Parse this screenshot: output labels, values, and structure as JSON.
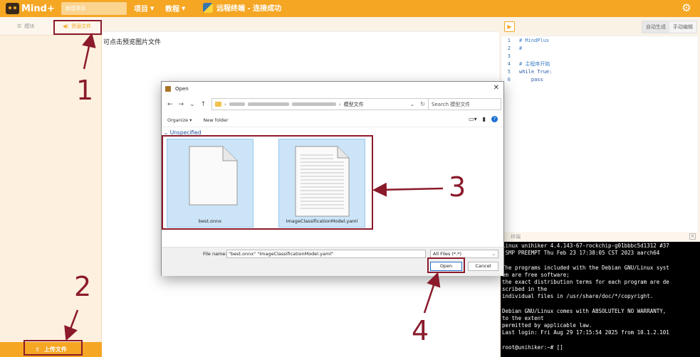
{
  "app": {
    "logo_text": "Mind+",
    "project_name": "新建项目",
    "menus": [
      {
        "label": "项目"
      },
      {
        "label": "教程"
      }
    ],
    "status_text": "远程终端 - 连接成功"
  },
  "left_panel": {
    "tabs": [
      {
        "label": "模块"
      },
      {
        "label": "资源文件"
      }
    ],
    "upload_label": "上传文件"
  },
  "middle": {
    "preview_tip": "可点击预览图片文件"
  },
  "editor": {
    "mode_tabs": [
      "自动生成",
      "手动编辑"
    ],
    "lines": [
      {
        "n": "1",
        "text": "# MindPlus"
      },
      {
        "n": "2",
        "text": "#"
      },
      {
        "n": "3",
        "text": ""
      },
      {
        "n": "4",
        "text": "# 主程序开始"
      },
      {
        "n": "5",
        "text": "while True:"
      },
      {
        "n": "6",
        "text": "    pass"
      }
    ]
  },
  "terminal": {
    "title": "终端",
    "output": "Linux unihiker 4.4.143-67-rockchip-g01bbbc5d1312 #37\n SMP PREEMPT Thu Feb 23 17:38:05 CST 2023 aarch64\n\nThe programs included with the Debian GNU/Linux syst\nem are free software;\nthe exact distribution terms for each program are de\nscribed in the\nindividual files in /usr/share/doc/*/copyright.\n\nDebian GNU/Linux comes with ABSOLUTELY NO WARRANTY,\nto the extent\npermitted by applicable law.\nLast login: Fri Aug 29 17:15:54 2025 from 10.1.2.101\n\nroot@unihiker:~# []"
  },
  "dialog": {
    "title": "Open",
    "breadcrumb_current": "模型文件",
    "search_placeholder": "Search 模型文件",
    "organize_label": "Organize ▾",
    "new_folder_label": "New folder",
    "group_label": "Unspecified",
    "files": [
      {
        "name": "best.onnx"
      },
      {
        "name": "ImageClassificationModel.yaml"
      }
    ],
    "file_name_label": "File name:",
    "file_name_value": "\"best.onnx\" \"ImageClassificationModel.yaml\"",
    "file_type_value": "All Files (*.*)",
    "open_label": "Open",
    "cancel_label": "Cancel"
  },
  "annotations": {
    "numbers": [
      "1",
      "2",
      "3",
      "4"
    ],
    "color": "#8b1a2b"
  },
  "colors": {
    "accent": "#f5a623",
    "selection": "#cce4f7"
  }
}
